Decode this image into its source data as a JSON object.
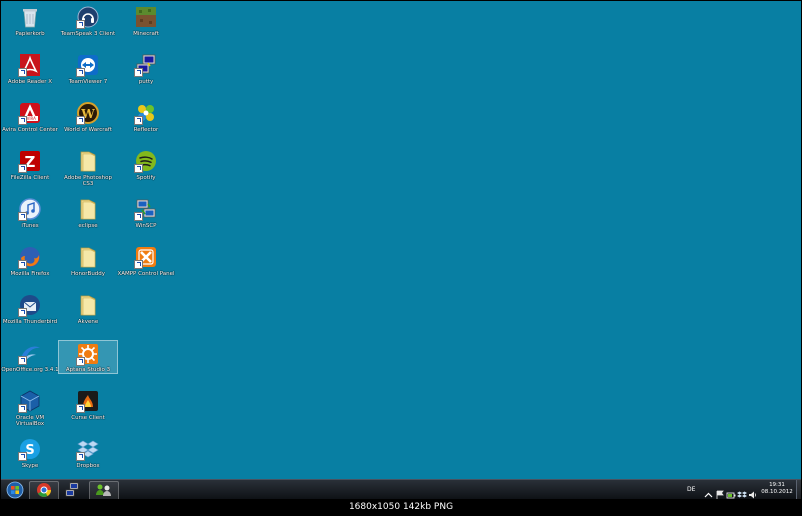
{
  "desktop_icons": [
    {
      "label": "Papierkorb",
      "icon": "recycle-bin-icon"
    },
    {
      "label": "TeamSpeak 3 Client",
      "icon": "teamspeak-icon"
    },
    {
      "label": "Minecraft",
      "icon": "minecraft-icon"
    },
    {
      "label": "Adobe Reader X",
      "icon": "adobe-reader-icon"
    },
    {
      "label": "TeamViewer 7",
      "icon": "teamviewer-icon"
    },
    {
      "label": "putty",
      "icon": "putty-icon"
    },
    {
      "label": "Avira Control Center",
      "icon": "avira-icon"
    },
    {
      "label": "World of Warcraft",
      "icon": "world-of-warcraft-icon"
    },
    {
      "label": "Reflector",
      "icon": "reflector-icon"
    },
    {
      "label": "FileZilla Client",
      "icon": "filezilla-icon"
    },
    {
      "label": "Adobe Photoshop CS3",
      "icon": "folder-icon"
    },
    {
      "label": "Spotify",
      "icon": "spotify-icon"
    },
    {
      "label": "iTunes",
      "icon": "itunes-icon"
    },
    {
      "label": "eclipse",
      "icon": "folder-icon"
    },
    {
      "label": "WinSCP",
      "icon": "winscp-icon"
    },
    {
      "label": "Mozilla Firefox",
      "icon": "firefox-icon"
    },
    {
      "label": "HonorBuddy",
      "icon": "folder-icon"
    },
    {
      "label": "XAMPP Control Panel",
      "icon": "xampp-icon"
    },
    {
      "label": "Mozilla Thunderbird",
      "icon": "thunderbird-icon"
    },
    {
      "label": "Akvene",
      "icon": "folder-icon"
    },
    {
      "label": "OpenOffice.org 3.4.1",
      "icon": "openoffice-icon"
    },
    {
      "label": "Aptana Studio 3",
      "icon": "aptana-icon"
    },
    {
      "label": "Oracle VM VirtualBox",
      "icon": "virtualbox-icon"
    },
    {
      "label": "Curse Client",
      "icon": "curse-icon"
    },
    {
      "label": "Skype",
      "icon": "skype-icon"
    },
    {
      "label": "Dropbox",
      "icon": "dropbox-icon"
    }
  ],
  "taskbar": {
    "pinned": [
      "start-orb-icon",
      "chrome-icon",
      "network-icon",
      "people-icon"
    ],
    "language": "DE",
    "clock_time": "19:31",
    "clock_date": "08.10.2012"
  },
  "caption": "1680x1050  142kb  PNG",
  "colors": {
    "desktop": "#087fa3",
    "taskbar": "#1a1f26"
  }
}
